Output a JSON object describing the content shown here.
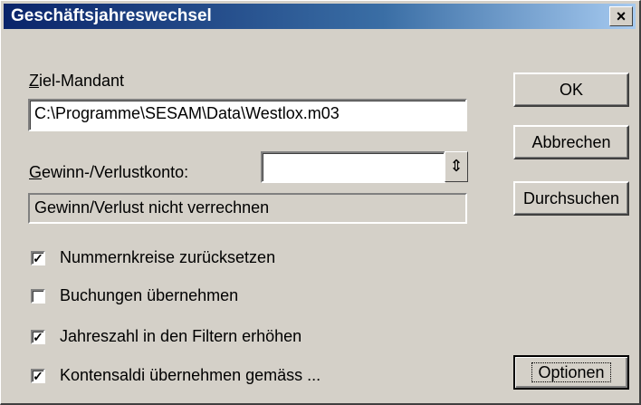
{
  "window": {
    "title": "Geschäftsjahreswechsel",
    "close_glyph": "×"
  },
  "target_client": {
    "label": "Ziel-Mandant",
    "value": "C:\\Programme\\SESAM\\Data\\Westlox.m03"
  },
  "profit_loss": {
    "label": "Gewinn-/Verlustkonto:",
    "value": "",
    "status": "Gewinn/Verlust nicht verrechnen"
  },
  "options": [
    {
      "label": "Nummernkreise zurücksetzen",
      "checked": true
    },
    {
      "label": "Buchungen übernehmen",
      "checked": false
    },
    {
      "label": "Jahreszahl in den Filtern erhöhen",
      "checked": true
    },
    {
      "label": "Kontensaldi übernehmen gemäss ...",
      "checked": true
    }
  ],
  "buttons": {
    "ok": "OK",
    "cancel": "Abbrechen",
    "browse": "Durchsuchen",
    "options": "Optionen"
  }
}
